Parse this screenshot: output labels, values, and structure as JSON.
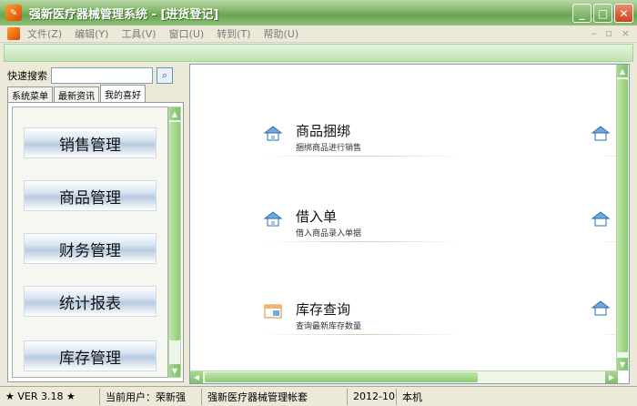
{
  "window": {
    "title": "强新医疗器械管理系统 - [进货登记]"
  },
  "menu": {
    "items": [
      "文件(Z)",
      "编辑(Y)",
      "工具(V)",
      "窗口(U)",
      "转到(T)",
      "帮助(U)"
    ],
    "mdi_min": "–",
    "mdi_restore": "▫",
    "mdi_close": "×"
  },
  "left": {
    "search_label": "快速搜索",
    "search_value": "",
    "tabs": [
      "系统菜单",
      "最新资讯",
      "我的喜好"
    ],
    "active_tab": "我的喜好",
    "nav": [
      "销售管理",
      "商品管理",
      "财务管理",
      "统计报表",
      "库存管理"
    ]
  },
  "main": {
    "items": [
      {
        "title": "商品捆绑",
        "desc": "捆绑商品进行销售",
        "icon": "house-icon"
      },
      {
        "title": "借入单",
        "desc": "借入商品录入单据",
        "icon": "house-icon"
      },
      {
        "title": "库存查询",
        "desc": "查询最新库存数量",
        "icon": "window-icon"
      }
    ]
  },
  "status": {
    "version": "★ VER 3.18 ★",
    "user": "当前用户：荣新强",
    "account": "强新医疗器械管理帐套",
    "date": "2012-10",
    "host": "本机"
  },
  "colors": {
    "title_green": "#6aa551",
    "strip_green": "#bfe3b0",
    "nav_blue": "#b7cbe0"
  }
}
